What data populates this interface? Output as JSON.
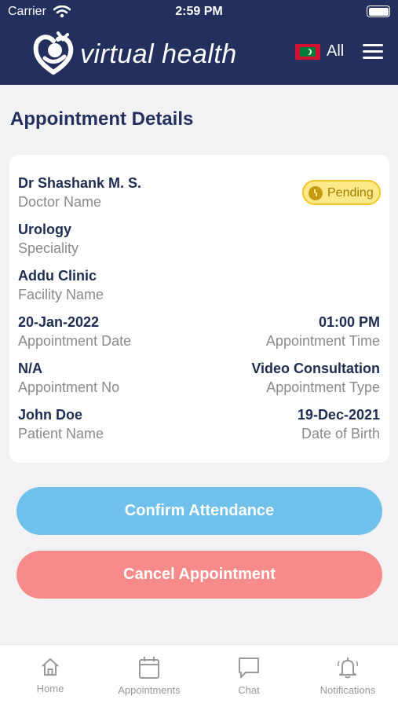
{
  "status_bar": {
    "carrier": "Carrier",
    "time": "2:59 PM"
  },
  "header": {
    "brand": "virtual health",
    "language": "All"
  },
  "page_title": "Appointment Details",
  "appointment": {
    "doctor_name": "Dr Shashank  M. S.",
    "doctor_name_label": "Doctor Name",
    "status": "Pending",
    "speciality": "Urology",
    "speciality_label": "Speciality",
    "facility": "Addu Clinic",
    "facility_label": "Facility Name",
    "date": "20-Jan-2022",
    "date_label": "Appointment Date",
    "time": "01:00 PM",
    "time_label": "Appointment Time",
    "number": "N/A",
    "number_label": "Appointment No",
    "type": "Video Consultation",
    "type_label": "Appointment Type",
    "patient_name": "John Doe",
    "patient_name_label": "Patient Name",
    "dob": "19-Dec-2021",
    "dob_label": "Date of Birth"
  },
  "actions": {
    "confirm": "Confirm Attendance",
    "cancel": "Cancel Appointment"
  },
  "tabbar": {
    "items": [
      {
        "label": "Home",
        "icon": "home-icon"
      },
      {
        "label": "Appointments",
        "icon": "calendar-icon"
      },
      {
        "label": "Chat",
        "icon": "chat-icon"
      },
      {
        "label": "Notifications",
        "icon": "bell-icon"
      }
    ]
  },
  "colors": {
    "header": "#23305e",
    "confirm": "#6fc0ea",
    "cancel": "#f78a8a",
    "pending": "#fde98a"
  }
}
